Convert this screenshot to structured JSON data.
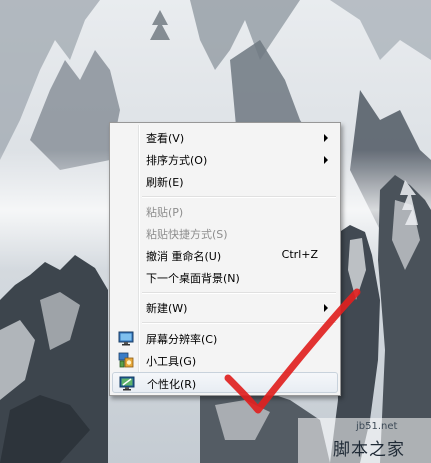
{
  "context_menu": {
    "items": [
      {
        "label": "查看(V)",
        "submenu": true
      },
      {
        "label": "排序方式(O)",
        "submenu": true
      },
      {
        "label": "刷新(E)"
      },
      {
        "label": "粘贴(P)",
        "disabled": true
      },
      {
        "label": "粘贴快捷方式(S)",
        "disabled": true
      },
      {
        "label": "撤消 重命名(U)",
        "shortcut": "Ctrl+Z"
      },
      {
        "label": "下一个桌面背景(N)"
      },
      {
        "label": "新建(W)",
        "submenu": true
      },
      {
        "label": "屏幕分辨率(C)",
        "icon": "screen-resolution-icon"
      },
      {
        "label": "小工具(G)",
        "icon": "gadgets-icon"
      },
      {
        "label": "个性化(R)",
        "icon": "personalize-icon",
        "highlighted": true
      }
    ]
  },
  "watermark": {
    "url": "jb51.net",
    "name": "脚本之家"
  },
  "colors": {
    "menu_background": "#f4f4f4",
    "disabled_text": "#8d8d8d",
    "annotation_checkmark": "#e0211f"
  }
}
